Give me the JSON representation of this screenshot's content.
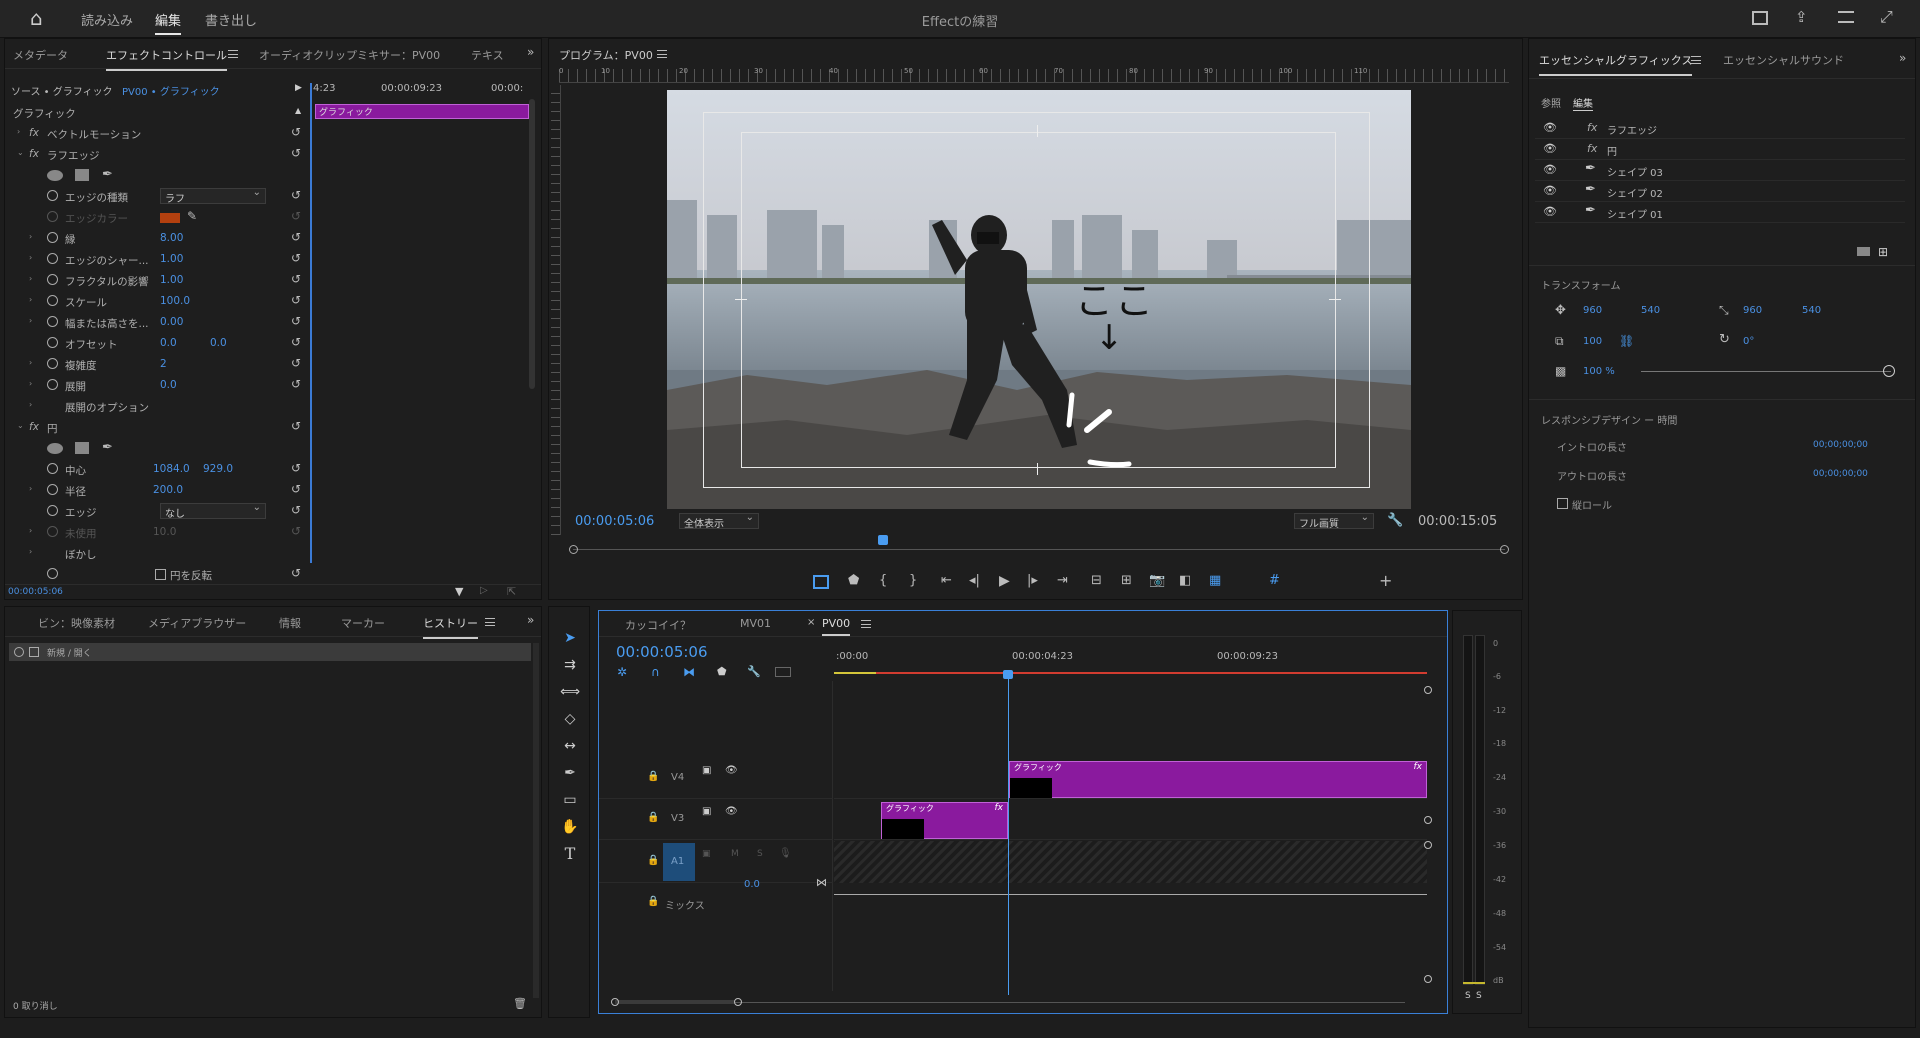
{
  "topbar": {
    "home": "⌂",
    "tabs": [
      "読み込み",
      "編集",
      "書き出し"
    ],
    "active_tab": "編集",
    "title": "Effectの練習"
  },
  "effect_panel": {
    "tabs": [
      "メタデータ",
      "エフェクトコントロール",
      "オーディオクリップミキサー：PV00",
      "テキス"
    ],
    "source_label": "ソース • グラフィック",
    "sequence_label": "PV00 • グラフィック",
    "timecodes": [
      "4:23",
      "00:00:09:23",
      "00:00:"
    ],
    "section_title": "グラフィック",
    "clip_label": "グラフィック",
    "current_time": "00:00:05:06",
    "rows": [
      {
        "label": "ベクトルモーション",
        "kind": "fx"
      },
      {
        "label": "ラフエッジ",
        "kind": "fx"
      },
      {
        "label": "エッジの種類",
        "value": "ラフ",
        "kind": "dropdown"
      },
      {
        "label": "エッジカラー",
        "kind": "color"
      },
      {
        "label": "縁",
        "value": "8.00"
      },
      {
        "label": "エッジのシャー...",
        "value": "1.00"
      },
      {
        "label": "フラクタルの影響",
        "value": "1.00"
      },
      {
        "label": "スケール",
        "value": "100.0"
      },
      {
        "label": "幅または高さを...",
        "value": "0.00"
      },
      {
        "label": "オフセット",
        "value": "0.0",
        "value2": "0.0"
      },
      {
        "label": "複雑度",
        "value": "2"
      },
      {
        "label": "展開",
        "value": "0.0"
      },
      {
        "label": "展開のオプション"
      },
      {
        "label": "円",
        "kind": "fx"
      },
      {
        "label": "中心",
        "value": "1084.0",
        "value2": "929.0"
      },
      {
        "label": "半径",
        "value": "200.0"
      },
      {
        "label": "エッジ",
        "value": "なし",
        "kind": "dropdown"
      },
      {
        "label": "未使用",
        "value": "10.0"
      },
      {
        "label": "ぼかし"
      },
      {
        "label": "円を反転"
      }
    ]
  },
  "program": {
    "title": "プログラム：PV00",
    "current_tc": "00:00:05:06",
    "fit": "全体表示",
    "quality": "フル画質",
    "duration_tc": "00:00:15:05",
    "ruler": [
      "0",
      "10",
      "20",
      "30",
      "40",
      "50",
      "60",
      "70",
      "80",
      "90",
      "100",
      "110"
    ],
    "overlay_text": "ここ"
  },
  "essential": {
    "tabs": [
      "エッセンシャルグラフィックス",
      "エッセンシャルサウンド"
    ],
    "subtabs": [
      "参照",
      "編集"
    ],
    "layers": [
      "ラフエッジ",
      "円",
      "シェイプ 03",
      "シェイプ 02",
      "シェイプ 01"
    ],
    "transform_title": "トランスフォーム",
    "pos_x": "960",
    "pos_y": "540",
    "anchor_x": "960",
    "anchor_y": "540",
    "scale": "100",
    "rotation": "0°",
    "opacity": "100 %",
    "responsive_title": "レスポンシブデザイン ー 時間",
    "intro_label": "イントロの長さ",
    "intro_value": "00;00;00;00",
    "outro_label": "アウトロの長さ",
    "outro_value": "00;00;00;00",
    "roll_label": "縦ロール"
  },
  "project": {
    "tabs": [
      "ビン：映像素材",
      "メディアブラウザー",
      "情報",
      "マーカー",
      "ヒストリー"
    ],
    "active_tab": "ヒストリー",
    "history_item": "新規 / 開く",
    "undo_label": "0 取り消し"
  },
  "timeline": {
    "tabs": [
      "カッコイイ？",
      "MV01",
      "PV00"
    ],
    "active_tab": "PV00",
    "current_tc": "00:00:05:06",
    "ruler": [
      ":00:00",
      "00:00:04:23",
      "00:00:09:23"
    ],
    "tracks": [
      "V4",
      "V3",
      "A1",
      "ミックス"
    ],
    "mix_value": "0.0",
    "clip_v4": "グラフィック",
    "clip_v3": "グラフィック",
    "meter_labels": [
      "0",
      "-6",
      "-12",
      "-18",
      "-24",
      "-30",
      "-36",
      "-42",
      "-48",
      "-54",
      "dB"
    ]
  }
}
